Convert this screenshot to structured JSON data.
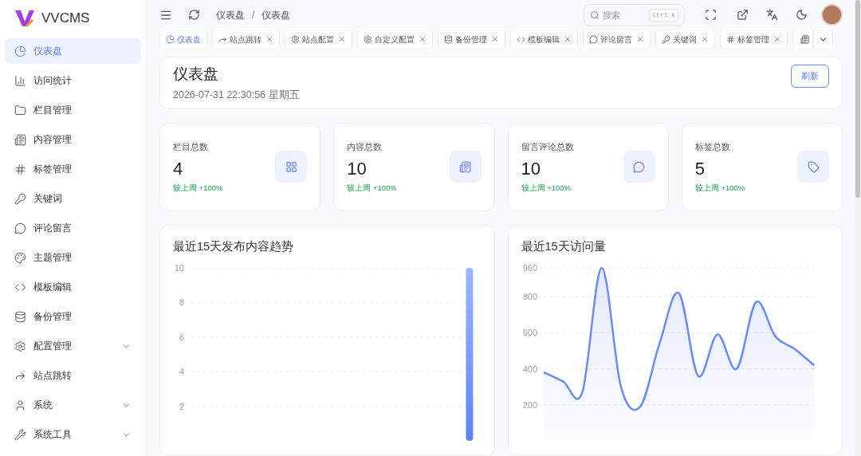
{
  "brand": {
    "name": "VVCMS"
  },
  "sidebar": {
    "items": [
      {
        "label": "仪表盘",
        "selected": true,
        "has_submenu": false
      },
      {
        "label": "访问统计",
        "selected": false,
        "has_submenu": false
      },
      {
        "label": "栏目管理",
        "selected": false,
        "has_submenu": false
      },
      {
        "label": "内容管理",
        "selected": false,
        "has_submenu": false
      },
      {
        "label": "标签管理",
        "selected": false,
        "has_submenu": false
      },
      {
        "label": "关键词",
        "selected": false,
        "has_submenu": false
      },
      {
        "label": "评论留言",
        "selected": false,
        "has_submenu": false
      },
      {
        "label": "主题管理",
        "selected": false,
        "has_submenu": false
      },
      {
        "label": "模板编辑",
        "selected": false,
        "has_submenu": false
      },
      {
        "label": "备份管理",
        "selected": false,
        "has_submenu": false
      },
      {
        "label": "配置管理",
        "selected": false,
        "has_submenu": true
      },
      {
        "label": "站点跳转",
        "selected": false,
        "has_submenu": false
      },
      {
        "label": "系统",
        "selected": false,
        "has_submenu": true
      },
      {
        "label": "系统工具",
        "selected": false,
        "has_submenu": true
      }
    ]
  },
  "header": {
    "breadcrumb": [
      "仪表盘",
      "仪表盘"
    ],
    "separator": "/",
    "search": {
      "placeholder": "搜索",
      "shortcut": "Ctrl k"
    }
  },
  "tabs": [
    {
      "label": "仪表盘",
      "selected": true,
      "closable": false
    },
    {
      "label": "站点跳转",
      "selected": false,
      "closable": true
    },
    {
      "label": "站点配置",
      "selected": false,
      "closable": true
    },
    {
      "label": "自定义配置",
      "selected": false,
      "closable": true
    },
    {
      "label": "备份管理",
      "selected": false,
      "closable": true
    },
    {
      "label": "模板编辑",
      "selected": false,
      "closable": true
    },
    {
      "label": "评论留言",
      "selected": false,
      "closable": true
    },
    {
      "label": "关键词",
      "selected": false,
      "closable": true
    },
    {
      "label": "标签管理",
      "selected": false,
      "closable": true
    }
  ],
  "page": {
    "title": "仪表盘",
    "datetime": "2026-07-31 22:30:56 星期五",
    "refresh_button": "刷新"
  },
  "stats": [
    {
      "label": "栏目总数",
      "value": "4",
      "change": "较上周 +100%"
    },
    {
      "label": "内容总数",
      "value": "10",
      "change": "较上周 +100%"
    },
    {
      "label": "留言评论总数",
      "value": "10",
      "change": "较上周 +100%"
    },
    {
      "label": "标签总数",
      "value": "5",
      "change": "较上周 +100%"
    }
  ],
  "charts": [
    {
      "title": "最近15天发布内容趋势",
      "chart_data": {
        "type": "bar",
        "grid": true,
        "ylim": [
          0,
          10
        ],
        "yticks": [
          2,
          4,
          6,
          8,
          10
        ],
        "values": [
          0,
          0,
          0,
          0,
          0,
          0,
          0,
          0,
          0,
          0,
          0,
          0,
          0,
          0,
          10
        ]
      }
    },
    {
      "title": "最近15天访问量",
      "chart_data": {
        "type": "area",
        "grid": true,
        "ylim": [
          0,
          960
        ],
        "yticks": [
          200,
          400,
          600,
          800,
          960
        ],
        "values": [
          380,
          330,
          270,
          960,
          300,
          190,
          540,
          820,
          360,
          590,
          400,
          770,
          580,
          510,
          420
        ]
      }
    }
  ]
}
